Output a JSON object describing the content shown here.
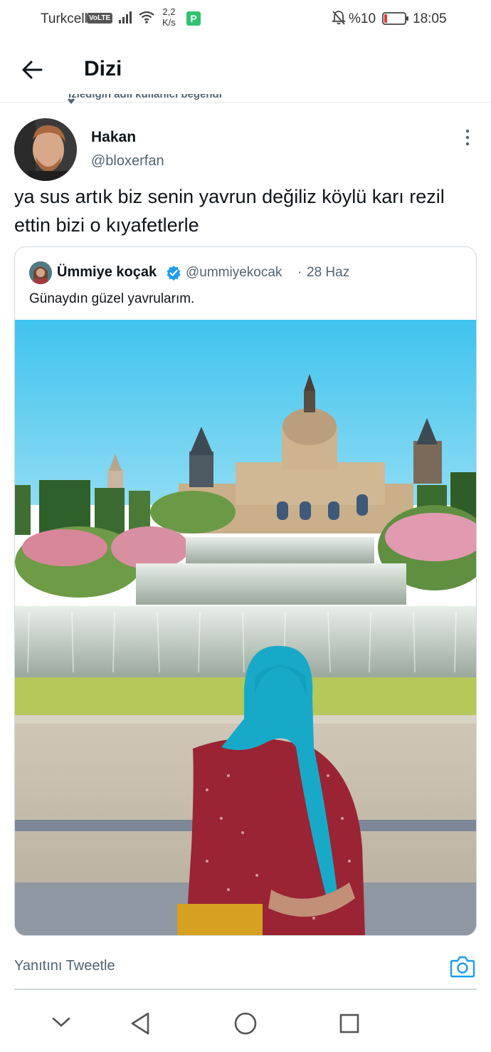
{
  "status_bar": {
    "carrier": "Turkcell",
    "volte": "VoLTE",
    "speed_value": "2,2",
    "speed_unit": "K/s",
    "app_badge": "P",
    "battery_percent": "%10",
    "time": "18:05",
    "icons": [
      "signal-icon",
      "wifi-icon",
      "mute-bell-icon",
      "battery-low-icon"
    ]
  },
  "header": {
    "title": "Dizi",
    "back_icon": "arrow-left-icon"
  },
  "liked_line": "İzlediğin adlı kullanıcı beğendi",
  "tweet": {
    "author_name": "Hakan",
    "author_handle": "@bloxerfan",
    "text": "ya sus artık biz senin yavrun değiliz köylü karı rezil ettin bizi o kıyafetlerle"
  },
  "quote": {
    "author_name": "Ümmiye koçak",
    "author_handle": "@ummiyekocak",
    "separator": "·",
    "date": "28 Haz",
    "text": "Günaydın güzel yavrularım."
  },
  "reply": {
    "placeholder": "Yanıtını Tweetle",
    "camera_icon": "camera-icon"
  },
  "colors": {
    "text_primary": "#0f1419",
    "text_secondary": "#536471",
    "verified": "#1d9bf0",
    "accent": "#1d9bf0",
    "border": "#cfd9de"
  },
  "nav_bar": {
    "icons": [
      "chevron-down-icon",
      "back-triangle-icon",
      "home-circle-icon",
      "recents-square-icon"
    ]
  }
}
